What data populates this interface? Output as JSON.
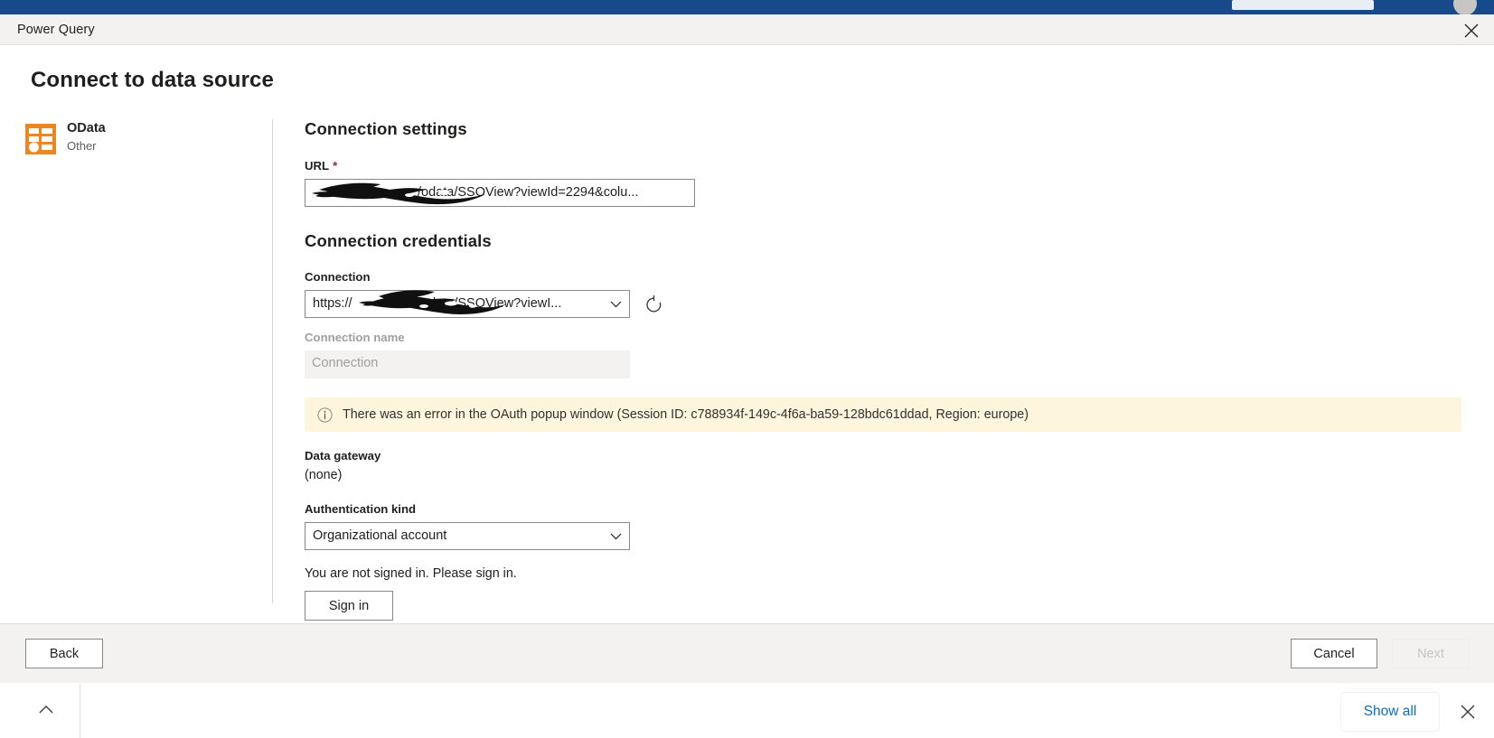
{
  "window": {
    "app_title": "Power Query",
    "close_icon": "close-icon"
  },
  "page": {
    "title": "Connect to data source"
  },
  "connector": {
    "name": "OData",
    "category": "Other",
    "icon": "odata-table-icon"
  },
  "connection_settings": {
    "heading": "Connection settings",
    "url": {
      "label": "URL",
      "required_marker": "*",
      "value": "https://██████████/odata/SSOView?viewId=2294&colu...",
      "visible_suffix": "/odata/SSOView?viewId=2294&colu..."
    }
  },
  "connection_credentials": {
    "heading": "Connection credentials",
    "connection": {
      "label": "Connection",
      "value_prefix": "https://",
      "visible_suffix": "odata/SSOView?viewI...",
      "chevron_icon": "chevron-down-icon",
      "refresh_icon": "refresh-icon"
    },
    "connection_name": {
      "label": "Connection name",
      "placeholder": "Connection",
      "value": ""
    },
    "message_bar": {
      "icon": "info-icon",
      "text": "There was an error in the OAuth popup window (Session ID: c788934f-149c-4f6a-ba59-128bdc61ddad, Region: europe)",
      "background_color": "#fdf6dd"
    },
    "data_gateway": {
      "label": "Data gateway",
      "value": "(none)"
    },
    "authentication_kind": {
      "label": "Authentication kind",
      "value": "Organizational account",
      "chevron_icon": "chevron-down-icon"
    },
    "sign_in": {
      "status_text": "You are not signed in. Please sign in.",
      "button_label": "Sign in"
    }
  },
  "footer": {
    "back_label": "Back",
    "cancel_label": "Cancel",
    "next_label": "Next"
  },
  "tray": {
    "chevron_icon": "chevron-up-icon",
    "show_all_label": "Show all",
    "close_icon": "close-icon"
  },
  "colors": {
    "accent_blue": "#174a8b",
    "link_blue": "#0f6cbd",
    "odata_orange": "#ec8623",
    "warning_bg": "#fdf6dd",
    "required_red": "#a4262c"
  }
}
